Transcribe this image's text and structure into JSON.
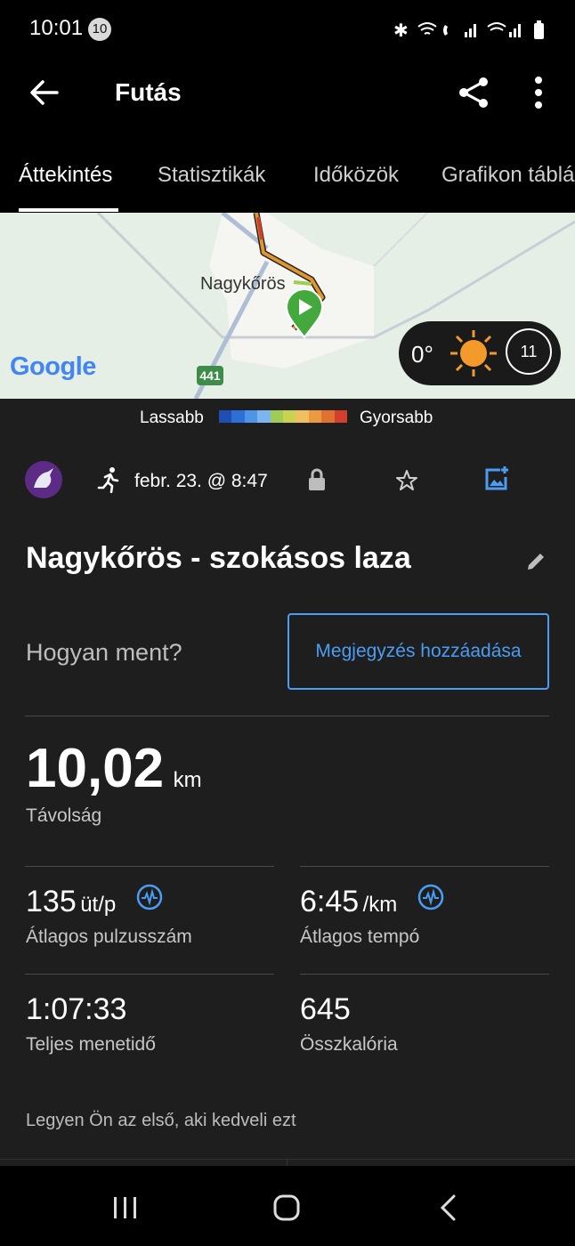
{
  "status_bar": {
    "time": "10:01",
    "badge": "10"
  },
  "header": {
    "title": "Futás"
  },
  "tabs": [
    {
      "label": "Áttekintés",
      "active": true
    },
    {
      "label": "Statisztikák"
    },
    {
      "label": "Időközök"
    },
    {
      "label": "Grafikon táblá"
    }
  ],
  "map": {
    "city_label": "Nagykőrös",
    "road_number": "441",
    "google_logo": "Google",
    "weather": {
      "temperature": "0°",
      "wind": "11"
    }
  },
  "legend": {
    "slower": "Lassabb",
    "faster": "Gyorsabb",
    "colors": [
      "#1f4fb5",
      "#2d6fd6",
      "#4d95e6",
      "#7bb6f0",
      "#9fcc55",
      "#c9d34f",
      "#f0c060",
      "#ec9a3e",
      "#e0712f",
      "#d0402c"
    ]
  },
  "activity": {
    "date": "febr. 23. @ 8:47",
    "name": "Nagykőrös - szokásos laza",
    "feeling_prompt": "Hogyan ment?",
    "add_note": "Megjegyzés hozzáadása"
  },
  "stats": {
    "distance": {
      "value": "10,02",
      "unit": "km",
      "label": "Távolság"
    },
    "heart_rate": {
      "value": "135",
      "unit": "üt/p",
      "label": "Átlagos pulzusszám"
    },
    "pace": {
      "value": "6:45",
      "unit": "/km",
      "label": "Átlagos tempó"
    },
    "duration": {
      "value": "1:07:33",
      "label": "Teljes menetidő"
    },
    "calories": {
      "value": "645",
      "label": "Összkalória"
    }
  },
  "social": {
    "like_text": "Legyen Ön az első, aki kedveli ezt"
  },
  "colors": {
    "accent": "#4a9df3",
    "background": "#1e1e1e"
  }
}
